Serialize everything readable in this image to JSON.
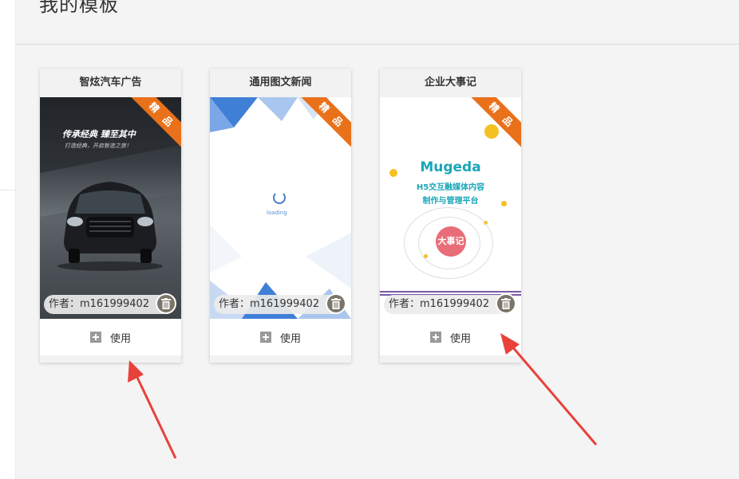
{
  "page": {
    "title": "我的模板"
  },
  "templates": [
    {
      "name": "智炫汽车广告",
      "badge": "精 品",
      "author": "作者：m161999402",
      "use_label": "使用",
      "preview_title": "传承经典 臻至其中",
      "preview_subtitle": "打造经典，开启智造之旅！"
    },
    {
      "name": "通用图文新闻",
      "badge": "精 品",
      "author": "作者：m161999402",
      "use_label": "使用",
      "preview_loading": "loading"
    },
    {
      "name": "企业大事记",
      "badge": "精 品",
      "author": "作者：m161999402",
      "use_label": "使用",
      "preview_brand": "Mugeda",
      "preview_line1": "H5交互融媒体内容",
      "preview_line2": "制作与管理平台",
      "preview_badge": "大事记"
    }
  ],
  "colors": {
    "ribbon": "#e8711a",
    "accent_teal": "#1aa6b7",
    "arrow": "#e8413a"
  },
  "icons": {
    "use": "plus-icon",
    "delete": "trash-icon"
  }
}
